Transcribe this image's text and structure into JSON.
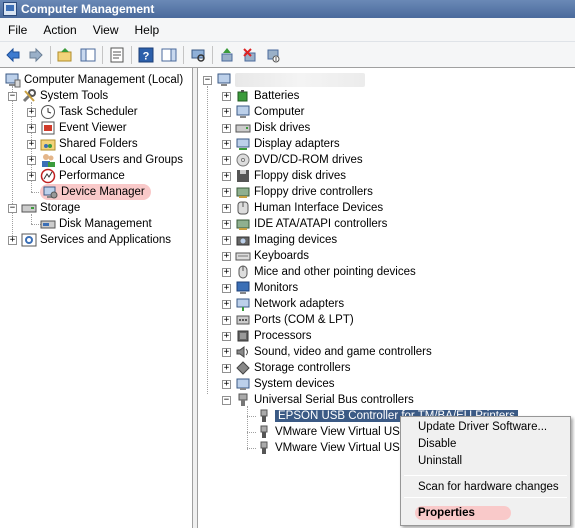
{
  "window": {
    "title": "Computer Management"
  },
  "menu": [
    "File",
    "Action",
    "View",
    "Help"
  ],
  "toolbar_icons": [
    "back-arrow-icon",
    "forward-arrow-icon",
    "up-folder-icon",
    "show-hide-tree-icon",
    "properties-icon",
    "help-icon",
    "show-action-pane-icon",
    "scan-hardware-icon",
    "update-driver-icon",
    "uninstall-icon",
    "disable-icon"
  ],
  "left_tree": {
    "root": "Computer Management (Local)",
    "system_tools": "System Tools",
    "task_scheduler": "Task Scheduler",
    "event_viewer": "Event Viewer",
    "shared_folders": "Shared Folders",
    "local_users": "Local Users and Groups",
    "performance": "Performance",
    "device_manager": "Device Manager",
    "storage": "Storage",
    "disk_management": "Disk Management",
    "services": "Services and Applications"
  },
  "devices": [
    {
      "label": "Batteries",
      "icon": "battery-icon"
    },
    {
      "label": "Computer",
      "icon": "computer-icon"
    },
    {
      "label": "Disk drives",
      "icon": "disk-drive-icon"
    },
    {
      "label": "Display adapters",
      "icon": "display-adapter-icon"
    },
    {
      "label": "DVD/CD-ROM drives",
      "icon": "dvd-icon"
    },
    {
      "label": "Floppy disk drives",
      "icon": "floppy-icon"
    },
    {
      "label": "Floppy drive controllers",
      "icon": "floppy-controller-icon"
    },
    {
      "label": "Human Interface Devices",
      "icon": "hid-icon"
    },
    {
      "label": "IDE ATA/ATAPI controllers",
      "icon": "ide-icon"
    },
    {
      "label": "Imaging devices",
      "icon": "camera-icon"
    },
    {
      "label": "Keyboards",
      "icon": "keyboard-icon"
    },
    {
      "label": "Mice and other pointing devices",
      "icon": "mouse-icon"
    },
    {
      "label": "Monitors",
      "icon": "monitor-icon"
    },
    {
      "label": "Network adapters",
      "icon": "network-icon"
    },
    {
      "label": "Ports (COM & LPT)",
      "icon": "port-icon"
    },
    {
      "label": "Processors",
      "icon": "processor-icon"
    },
    {
      "label": "Sound, video and game controllers",
      "icon": "sound-icon"
    },
    {
      "label": "Storage controllers",
      "icon": "storage-controller-icon"
    },
    {
      "label": "System devices",
      "icon": "system-devices-icon"
    },
    {
      "label": "Universal Serial Bus controllers",
      "icon": "usb-icon"
    }
  ],
  "usb_children": [
    "EPSON USB Controller for TM/BA/EU Printers",
    "VMware View Virtual USB Hub",
    "VMware View Virtual USB Hub"
  ],
  "context_menu": {
    "update": "Update Driver Software...",
    "disable": "Disable",
    "uninstall": "Uninstall",
    "scan": "Scan for hardware changes",
    "properties": "Properties"
  }
}
